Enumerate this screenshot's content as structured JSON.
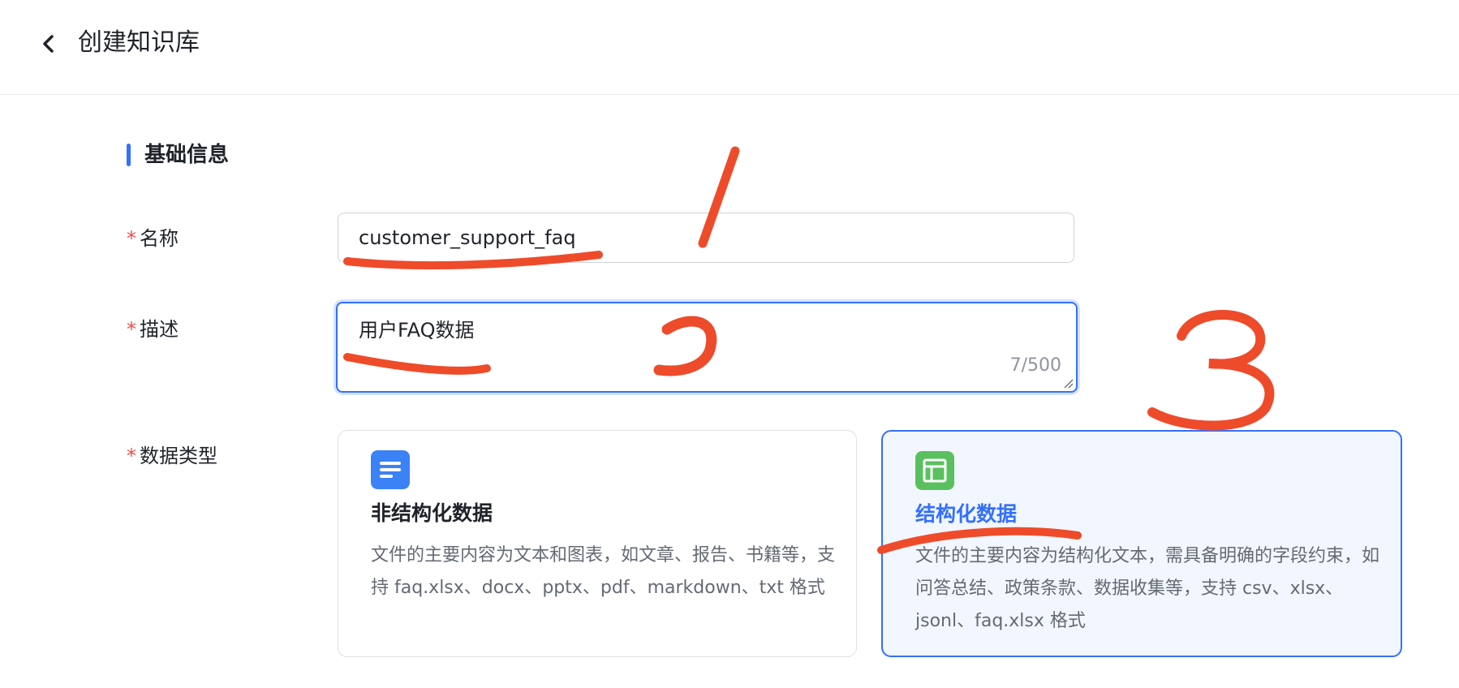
{
  "header": {
    "title": "创建知识库"
  },
  "section": {
    "title": "基础信息"
  },
  "form": {
    "required_mark": "*",
    "name": {
      "label": "名称",
      "value": "customer_support_faq"
    },
    "description": {
      "label": "描述",
      "value": "用户FAQ数据",
      "char_count": "7/500"
    },
    "data_type": {
      "label": "数据类型",
      "selected": "structured",
      "options": [
        {
          "id": "unstructured",
          "icon": "document-icon",
          "title": "非结构化数据",
          "description": "文件的主要内容为文本和图表，如文章、报告、书籍等，支持 faq.xlsx、docx、pptx、pdf、markdown、txt 格式"
        },
        {
          "id": "structured",
          "icon": "table-icon",
          "title": "结构化数据",
          "description": "文件的主要内容为结构化文本，需具备明确的字段约束，如问答总结、政策条款、数据收集等，支持 csv、xlsx、jsonl、faq.xlsx 格式"
        }
      ]
    }
  },
  "annotations": {
    "marks": [
      "1",
      "2",
      "3"
    ],
    "color": "#ee4b2b"
  },
  "colors": {
    "accent": "#3370ff",
    "required": "#f54a45",
    "doc_icon": "#3b82f6",
    "table_icon": "#5ac05f"
  }
}
